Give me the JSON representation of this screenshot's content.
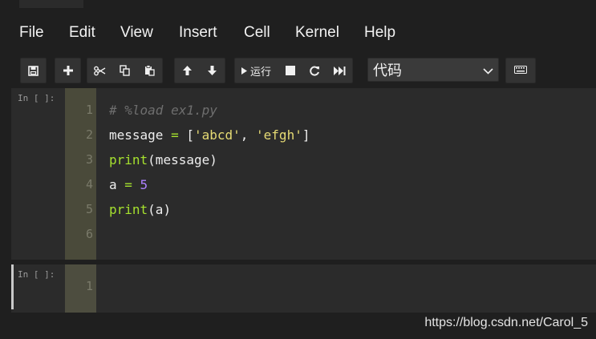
{
  "menubar": {
    "items": [
      "File",
      "Edit",
      "View",
      "Insert",
      "Cell",
      "Kernel",
      "Help"
    ]
  },
  "toolbar": {
    "run_label": "运行",
    "cell_type": "代码",
    "icons": [
      "save-icon",
      "plus-icon",
      "cut-icon",
      "copy-icon",
      "paste-icon",
      "arrow-up-icon",
      "arrow-down-icon",
      "run-icon",
      "stop-icon",
      "restart-icon",
      "fast-forward-icon",
      "chevron-down-icon",
      "keyboard-icon"
    ]
  },
  "cells": [
    {
      "prompt": "In [ ]:",
      "line_numbers": [
        "1",
        "2",
        "3",
        "4",
        "5",
        "6"
      ],
      "lines": [
        [
          {
            "t": "# %load ex1.py",
            "c": "comment"
          }
        ],
        [
          {
            "t": "message ",
            "c": ""
          },
          {
            "t": "=",
            "c": "op"
          },
          {
            "t": " [",
            "c": ""
          },
          {
            "t": "'abcd'",
            "c": "str"
          },
          {
            "t": ", ",
            "c": ""
          },
          {
            "t": "'efgh'",
            "c": "str"
          },
          {
            "t": "]",
            "c": ""
          }
        ],
        [
          {
            "t": "print",
            "c": "kw"
          },
          {
            "t": "(message)",
            "c": ""
          }
        ],
        [
          {
            "t": "a ",
            "c": ""
          },
          {
            "t": "=",
            "c": "op"
          },
          {
            "t": " ",
            "c": ""
          },
          {
            "t": "5",
            "c": "num"
          }
        ],
        [
          {
            "t": "print",
            "c": "kw"
          },
          {
            "t": "(a)",
            "c": ""
          }
        ],
        []
      ]
    },
    {
      "prompt": "In [ ]:",
      "line_numbers": [
        "1"
      ],
      "lines": [
        []
      ]
    }
  ],
  "watermark": "https://blog.csdn.net/Carol_5",
  "colors": {
    "background": "#1f1f1f",
    "cell_bg": "#2b2b2b",
    "gutter": "#4a4a3a",
    "keyword": "#a6e22e",
    "string": "#e6db74",
    "number": "#ae81ff",
    "comment": "#6e6e6e"
  }
}
